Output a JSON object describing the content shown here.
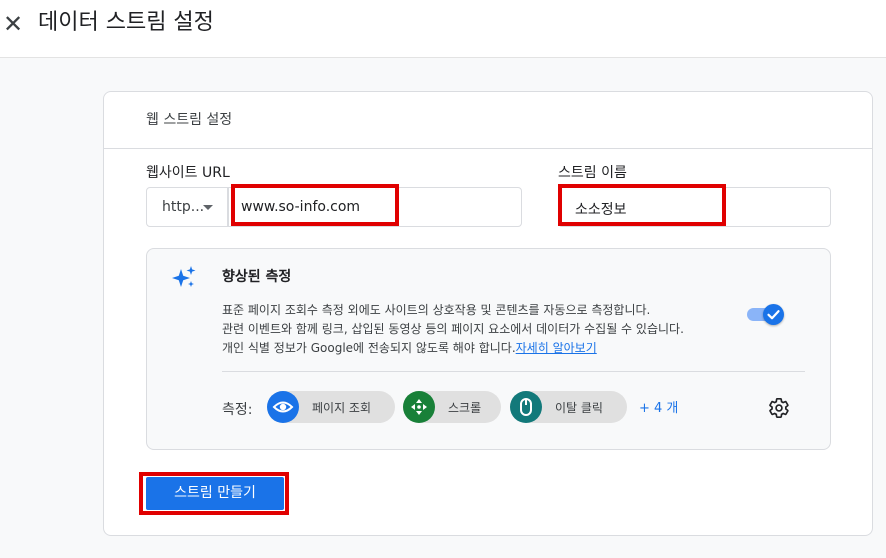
{
  "header": {
    "close_icon": "close-icon",
    "title": "데이터 스트림 설정"
  },
  "card": {
    "title": "웹 스트림 설정",
    "website_url_label": "웹사이트 URL",
    "protocol_value": "http...",
    "url_value": "www.so-info.com",
    "stream_name_label": "스트림 이름",
    "stream_name_value": "소소정보"
  },
  "enhanced": {
    "icon": "sparkle-icon",
    "title": "향상된 측정",
    "desc_line1": "표준 페이지 조회수 측정 외에도 사이트의 상호작용 및 콘텐츠를 자동으로 측정합니다.",
    "desc_line2": "관련 이벤트와 함께 링크, 삽입된 동영상 등의 페이지 요소에서 데이터가 수집될 수 있습니다.",
    "desc_line3": "개인 식별 정보가 Google에 전송되지 않도록 해야 합니다.",
    "learn_more": "자세히 알아보기",
    "toggle_on": true,
    "measure_label": "측정:",
    "chips": [
      {
        "label": "페이지 조회",
        "icon": "eye-icon",
        "color": "#1a73e8"
      },
      {
        "label": "스크롤",
        "icon": "scroll-arrows-icon",
        "color": "#188038"
      },
      {
        "label": "이탈 클릭",
        "icon": "mouse-icon",
        "color": "#12797a"
      }
    ],
    "more": "+ 4 개",
    "settings_icon": "gear-icon"
  },
  "actions": {
    "create_label": "스트림 만들기"
  },
  "colors": {
    "accent": "#1a73e8",
    "highlight": "#e00000"
  }
}
